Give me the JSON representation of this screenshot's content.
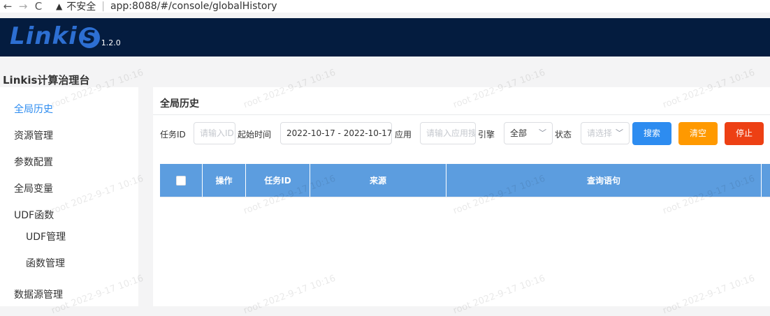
{
  "browser": {
    "back_icon": "←",
    "forward_icon": "→",
    "reload_icon": "C",
    "warning_icon": "▲",
    "insecure_label": "不安全",
    "url": "app:8088/#/console/globalHistory"
  },
  "header": {
    "logo_text": "Linki",
    "logo_letter": "S",
    "version": "1.2.0",
    "brand_color": "#2d6fd2",
    "background": "#041c3f"
  },
  "sidebar": {
    "platform_title": "Linkis计算治理台",
    "items": [
      {
        "label": "全局历史"
      },
      {
        "label": "资源管理"
      },
      {
        "label": "参数配置"
      },
      {
        "label": "全局变量"
      },
      {
        "label": "UDF函数"
      },
      {
        "label": "UDF管理"
      },
      {
        "label": "函数管理"
      },
      {
        "label": "数据源管理"
      }
    ]
  },
  "main": {
    "title": "全局历史",
    "filters": {
      "task_id_label": "任务ID",
      "task_id_placeholder": "请输入ID",
      "start_time_label": "起始时间",
      "date_range": "2022-10-17 - 2022-10-17",
      "app_label": "应用",
      "app_placeholder": "请输入应用搜",
      "engine_label": "引擎",
      "engine_value": "全部",
      "status_label": "状态",
      "status_placeholder": "请选择"
    },
    "buttons": {
      "search": "搜索",
      "clear": "清空",
      "stop": "停止"
    },
    "table": {
      "columns": [
        "操作",
        "任务ID",
        "来源",
        "查询语句"
      ],
      "header_color": "#5c9ddf",
      "rows": []
    }
  },
  "watermark": {
    "text": "root 2022-9-17 10:16"
  }
}
